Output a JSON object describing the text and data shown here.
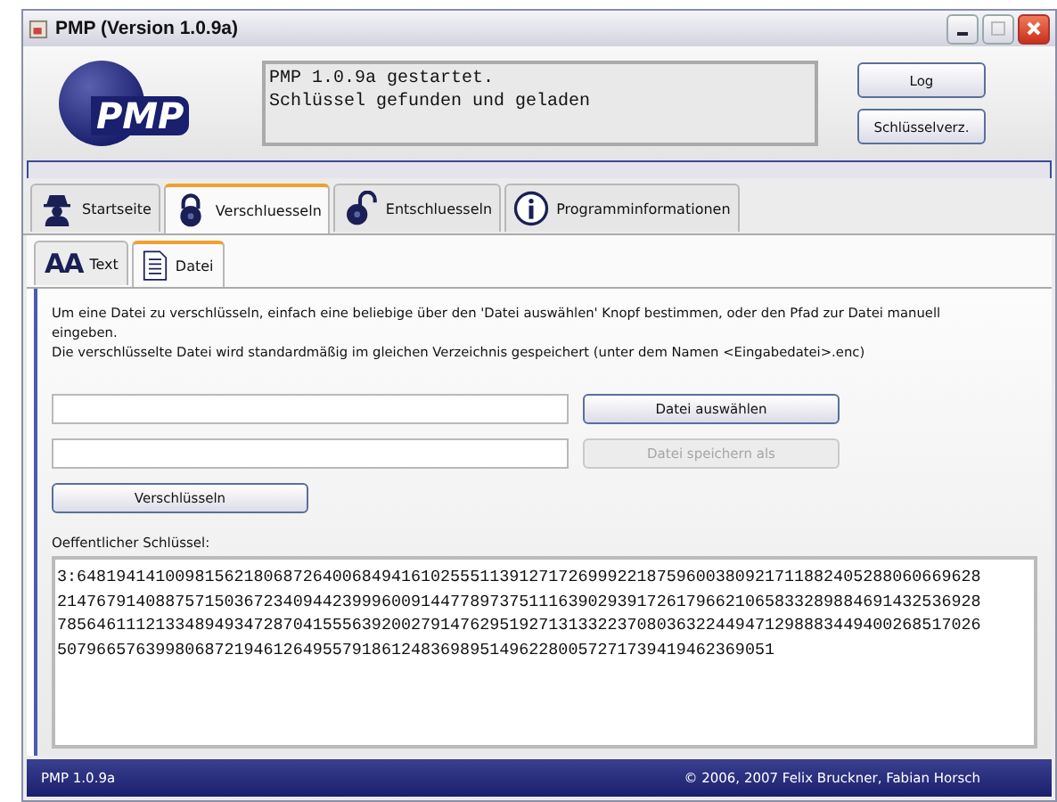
{
  "window": {
    "title": "PMP (Version 1.0.9a)"
  },
  "header": {
    "logo": "PMP",
    "log_lines": [
      "PMP 1.0.9a gestartet.",
      "Schlüssel gefunden und geladen"
    ],
    "buttons": [
      "Log",
      "Schlüsselverz."
    ]
  },
  "tabs": [
    {
      "label": "Startseite",
      "selected": false
    },
    {
      "label": "Verschluesseln",
      "selected": true
    },
    {
      "label": "Entschluesseln",
      "selected": false
    },
    {
      "label": "Programminformationen",
      "selected": false
    }
  ],
  "subtabs": [
    {
      "label": "Text",
      "icon_text": "AA",
      "selected": false
    },
    {
      "label": "Datei",
      "selected": true
    }
  ],
  "description": [
    "Um eine Datei zu verschlüsseln, einfach eine beliebige über den 'Datei auswählen' Knopf bestimmen, oder den Pfad zur Datei manuell eingeben.",
    "Die verschlüsselte Datei wird standardmäßig im gleichen Verzeichnis gespeichert (unter dem Namen <Eingabedatei>.enc)"
  ],
  "file_rows": [
    {
      "button": "Datei auswählen",
      "disabled": false
    },
    {
      "button": "Datei speichern als",
      "disabled": true
    }
  ],
  "encrypt_button": "Verschlüsseln",
  "key_label": "Oeffentlicher Schlüssel:",
  "key_lines": [
    "3:64819414100981562180687264006849416102555113912717269992218759600380921711882405288060669628",
    "2147679140887571503672340944239996009144778973751116390293917261796621065833289884691432536928",
    "7856461112133489493472870415556392002791476295192713133223708036322449471298883449400268517026",
    "5079665763998068721946126495579186124836989514962280057271739419462369051"
  ],
  "status_bar": {
    "left": "PMP 1.0.9a",
    "right": "© 2006, 2007 Felix Bruckner, Fabian Horsch"
  }
}
